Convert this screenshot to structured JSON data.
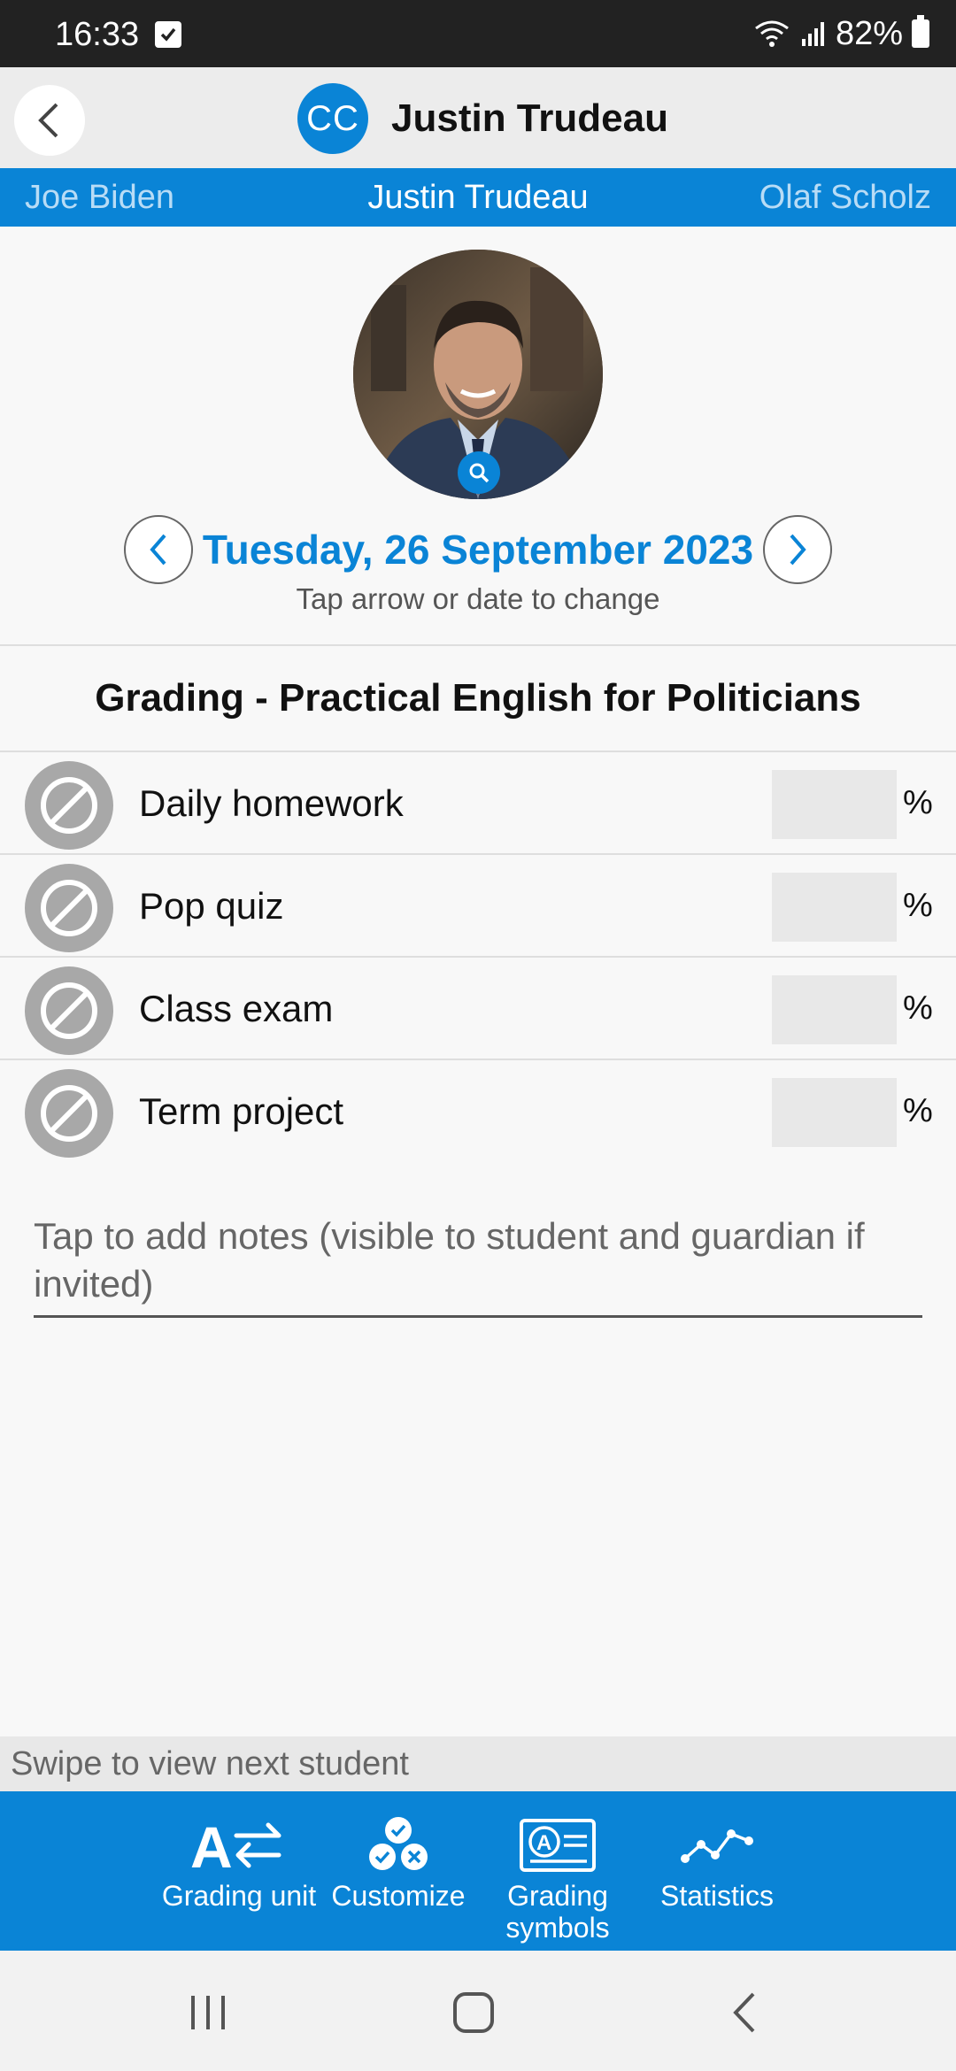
{
  "status_bar": {
    "time": "16:33",
    "battery": "82%"
  },
  "header": {
    "avatar_initials": "CC",
    "title": "Justin Trudeau"
  },
  "student_switcher": {
    "previous": "Joe Biden",
    "current": "Justin Trudeau",
    "next": "Olaf Scholz"
  },
  "date_nav": {
    "date": "Tuesday, 26 September 2023",
    "hint": "Tap arrow or date to change"
  },
  "grading": {
    "title": "Grading - Practical English for Politicians",
    "percent_symbol": "%",
    "items": [
      {
        "label": "Daily homework",
        "value": ""
      },
      {
        "label": "Pop quiz",
        "value": ""
      },
      {
        "label": "Class exam",
        "value": ""
      },
      {
        "label": "Term project",
        "value": ""
      }
    ]
  },
  "notes": {
    "placeholder": "Tap to add notes (visible to student and guardian if invited)"
  },
  "swipe_hint": "Swipe to view next student",
  "toolbar": {
    "items": [
      {
        "label": "Grading unit",
        "icon": "grading-unit-icon"
      },
      {
        "label": "Customize",
        "icon": "customize-icon"
      },
      {
        "label": "Grading symbols",
        "icon": "grading-symbols-icon"
      },
      {
        "label": "Statistics",
        "icon": "statistics-icon"
      }
    ]
  },
  "colors": {
    "accent": "#0a84d6",
    "status_bar": "#222222",
    "header": "#ececec"
  }
}
